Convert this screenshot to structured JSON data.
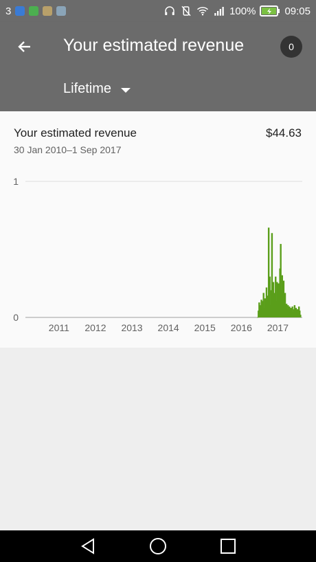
{
  "status_bar": {
    "notification_count": "3",
    "battery": "100%",
    "time": "09:05",
    "icons": [
      "app-icon-blue",
      "app-icon-green",
      "app-icon-map",
      "app-icon-gallery",
      "headphones-icon",
      "vibrate-off-icon",
      "wifi-icon",
      "signal-icon",
      "battery-icon"
    ]
  },
  "app_bar": {
    "title": "Your estimated revenue",
    "badge": "0",
    "range_label": "Lifetime"
  },
  "card": {
    "title": "Your estimated revenue",
    "amount": "$44.63",
    "date_range": "30 Jan 2010–1 Sep 2017"
  },
  "chart_data": {
    "type": "area",
    "title": "",
    "xlabel": "",
    "ylabel": "",
    "ylim": [
      0,
      1
    ],
    "yticks": [
      "0",
      "1"
    ],
    "xticks": [
      "2011",
      "2012",
      "2013",
      "2014",
      "2015",
      "2016",
      "2017"
    ],
    "xlim": [
      2010.08,
      2017.67
    ],
    "series": [
      {
        "color": "#5a9e1a",
        "points": [
          [
            2016.45,
            0.0
          ],
          [
            2016.47,
            0.05
          ],
          [
            2016.49,
            0.11
          ],
          [
            2016.51,
            0.04
          ],
          [
            2016.53,
            0.09
          ],
          [
            2016.55,
            0.13
          ],
          [
            2016.57,
            0.06
          ],
          [
            2016.59,
            0.12
          ],
          [
            2016.61,
            0.18
          ],
          [
            2016.63,
            0.07
          ],
          [
            2016.65,
            0.14
          ],
          [
            2016.67,
            0.1
          ],
          [
            2016.69,
            0.22
          ],
          [
            2016.71,
            0.08
          ],
          [
            2016.73,
            0.16
          ],
          [
            2016.75,
            0.66
          ],
          [
            2016.76,
            0.12
          ],
          [
            2016.78,
            0.3
          ],
          [
            2016.8,
            0.09
          ],
          [
            2016.82,
            0.2
          ],
          [
            2016.84,
            0.62
          ],
          [
            2016.86,
            0.14
          ],
          [
            2016.88,
            0.26
          ],
          [
            2016.9,
            0.1
          ],
          [
            2016.92,
            0.18
          ],
          [
            2016.94,
            0.3
          ],
          [
            2016.96,
            0.12
          ],
          [
            2016.98,
            0.26
          ],
          [
            2017.0,
            0.17
          ],
          [
            2017.02,
            0.25
          ],
          [
            2017.04,
            0.14
          ],
          [
            2017.06,
            0.36
          ],
          [
            2017.08,
            0.54
          ],
          [
            2017.1,
            0.2
          ],
          [
            2017.12,
            0.31
          ],
          [
            2017.14,
            0.15
          ],
          [
            2017.16,
            0.27
          ],
          [
            2017.18,
            0.12
          ],
          [
            2017.2,
            0.18
          ],
          [
            2017.22,
            0.08
          ],
          [
            2017.24,
            0.1
          ],
          [
            2017.26,
            0.06
          ],
          [
            2017.28,
            0.09
          ],
          [
            2017.3,
            0.05
          ],
          [
            2017.32,
            0.08
          ],
          [
            2017.34,
            0.04
          ],
          [
            2017.36,
            0.07
          ],
          [
            2017.38,
            0.05
          ],
          [
            2017.4,
            0.08
          ],
          [
            2017.42,
            0.04
          ],
          [
            2017.44,
            0.06
          ],
          [
            2017.46,
            0.09
          ],
          [
            2017.48,
            0.05
          ],
          [
            2017.5,
            0.07
          ],
          [
            2017.52,
            0.04
          ],
          [
            2017.54,
            0.06
          ],
          [
            2017.56,
            0.03
          ],
          [
            2017.58,
            0.08
          ],
          [
            2017.6,
            0.05
          ],
          [
            2017.62,
            0.02
          ]
        ]
      }
    ],
    "grid": "horizontal"
  }
}
